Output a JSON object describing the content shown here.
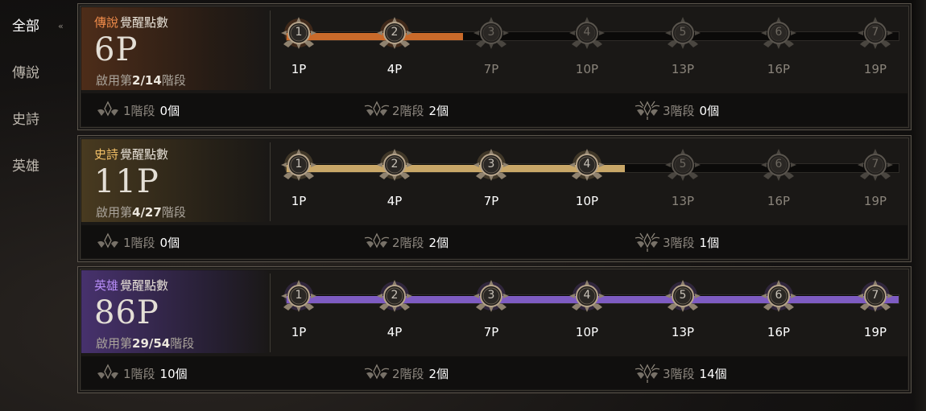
{
  "sidebar": {
    "items": [
      {
        "label": "全部",
        "active": true
      },
      {
        "label": "傳說",
        "active": false
      },
      {
        "label": "史詩",
        "active": false
      },
      {
        "label": "英雄",
        "active": false
      }
    ],
    "active_mark": "«"
  },
  "colors": {
    "legend": "#c96a2a",
    "epic": "#c9a768",
    "hero": "#7e5cc2"
  },
  "panels": [
    {
      "rarity": "傳說",
      "title_suffix": "覺醒點數",
      "points": "6P",
      "stage_prefix": "啟用第",
      "stage_value": "2/14",
      "stage_suffix": "階段",
      "progress_fraction": 0.288,
      "active_nodes": 2,
      "nodes": [
        {
          "num": "1",
          "label": "1P"
        },
        {
          "num": "2",
          "label": "4P"
        },
        {
          "num": "3",
          "label": "7P"
        },
        {
          "num": "4",
          "label": "10P"
        },
        {
          "num": "5",
          "label": "13P"
        },
        {
          "num": "6",
          "label": "16P"
        },
        {
          "num": "7",
          "label": "19P"
        }
      ],
      "stages": [
        {
          "label": "1階段",
          "count": "0個",
          "icon": "stage1-emblem-icon"
        },
        {
          "label": "2階段",
          "count": "2個",
          "icon": "stage2-emblem-icon"
        },
        {
          "label": "3階段",
          "count": "0個",
          "icon": "stage3-emblem-icon"
        }
      ]
    },
    {
      "rarity": "史詩",
      "title_suffix": "覺醒點數",
      "points": "11P",
      "stage_prefix": "啟用第",
      "stage_value": "4/27",
      "stage_suffix": "階段",
      "progress_fraction": 0.553,
      "active_nodes": 4,
      "nodes": [
        {
          "num": "1",
          "label": "1P"
        },
        {
          "num": "2",
          "label": "4P"
        },
        {
          "num": "3",
          "label": "7P"
        },
        {
          "num": "4",
          "label": "10P"
        },
        {
          "num": "5",
          "label": "13P"
        },
        {
          "num": "6",
          "label": "16P"
        },
        {
          "num": "7",
          "label": "19P"
        }
      ],
      "stages": [
        {
          "label": "1階段",
          "count": "0個",
          "icon": "stage1-emblem-icon"
        },
        {
          "label": "2階段",
          "count": "2個",
          "icon": "stage2-emblem-icon"
        },
        {
          "label": "3階段",
          "count": "1個",
          "icon": "stage3-emblem-icon"
        }
      ]
    },
    {
      "rarity": "英雄",
      "title_suffix": "覺醒點數",
      "points": "86P",
      "stage_prefix": "啟用第",
      "stage_value": "29/54",
      "stage_suffix": "階段",
      "progress_fraction": 1.0,
      "active_nodes": 7,
      "nodes": [
        {
          "num": "1",
          "label": "1P"
        },
        {
          "num": "2",
          "label": "4P"
        },
        {
          "num": "3",
          "label": "7P"
        },
        {
          "num": "4",
          "label": "10P"
        },
        {
          "num": "5",
          "label": "13P"
        },
        {
          "num": "6",
          "label": "16P"
        },
        {
          "num": "7",
          "label": "19P"
        }
      ],
      "stages": [
        {
          "label": "1階段",
          "count": "10個",
          "icon": "stage1-emblem-icon"
        },
        {
          "label": "2階段",
          "count": "2個",
          "icon": "stage2-emblem-icon"
        },
        {
          "label": "3階段",
          "count": "14個",
          "icon": "stage3-emblem-icon"
        }
      ]
    }
  ]
}
